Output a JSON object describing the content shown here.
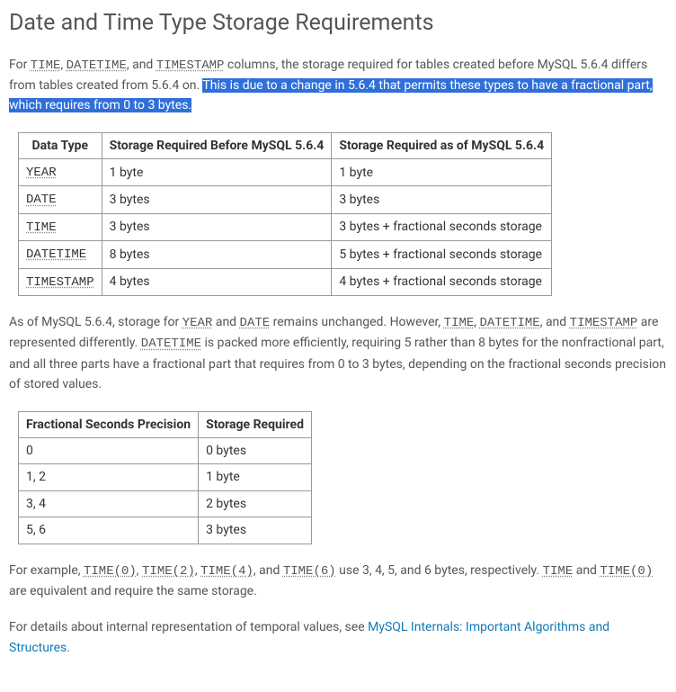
{
  "heading": "Date and Time Type Storage Requirements",
  "intro": {
    "p1a": "For ",
    "t_time": "TIME",
    "c1": ", ",
    "t_datetime": "DATETIME",
    "c2": ", and ",
    "t_timestamp": "TIMESTAMP",
    "p1b": " columns, the storage required for tables created before MySQL 5.6.4 differs from tables created from 5.6.4 on. ",
    "hl": "This is due to a change in 5.6.4 that permits these types to have a fractional part, which requires from 0 to 3 bytes."
  },
  "table1": {
    "headers": [
      "Data Type",
      "Storage Required Before MySQL 5.6.4",
      "Storage Required as of MySQL 5.6.4"
    ],
    "rows": [
      {
        "type": "YEAR",
        "before": "1 byte",
        "after": "1 byte"
      },
      {
        "type": "DATE",
        "before": "3 bytes",
        "after": "3 bytes"
      },
      {
        "type": "TIME",
        "before": "3 bytes",
        "after": "3 bytes + fractional seconds storage"
      },
      {
        "type": "DATETIME",
        "before": "8 bytes",
        "after": "5 bytes + fractional seconds storage"
      },
      {
        "type": "TIMESTAMP",
        "before": "4 bytes",
        "after": "4 bytes + fractional seconds storage"
      }
    ]
  },
  "middle": {
    "a": "As of MySQL 5.6.4, storage for ",
    "year": "YEAR",
    "b": " and ",
    "date": "DATE",
    "c": " remains unchanged. However, ",
    "time": "TIME",
    "d": ", ",
    "datetime": "DATETIME",
    "e": ", and ",
    "timestamp": "TIMESTAMP",
    "f": " are represented differently. ",
    "datetime2": "DATETIME",
    "g": " is packed more efficiently, requiring 5 rather than 8 bytes for the nonfractional part, and all three parts have a fractional part that requires from 0 to 3 bytes, depending on the fractional seconds precision of stored values."
  },
  "table2": {
    "headers": [
      "Fractional Seconds Precision",
      "Storage Required"
    ],
    "rows": [
      {
        "p": "0",
        "s": "0 bytes"
      },
      {
        "p": "1, 2",
        "s": "1 byte"
      },
      {
        "p": "3, 4",
        "s": "2 bytes"
      },
      {
        "p": "5, 6",
        "s": "3 bytes"
      }
    ]
  },
  "example": {
    "a": "For example, ",
    "t0": "TIME(0)",
    "c1": ", ",
    "t2": "TIME(2)",
    "c2": ", ",
    "t4": "TIME(4)",
    "c3": ", and ",
    "t6": "TIME(6)",
    "b": " use 3, 4, 5, and 6 bytes, respectively. ",
    "time": "TIME",
    "c": " and ",
    "t0b": "TIME(0)",
    "d": " are equivalent and require the same storage."
  },
  "footer": {
    "a": "For details about internal representation of temporal values, see ",
    "link": "MySQL Internals: Important Algorithms and Structures",
    "b": "."
  }
}
